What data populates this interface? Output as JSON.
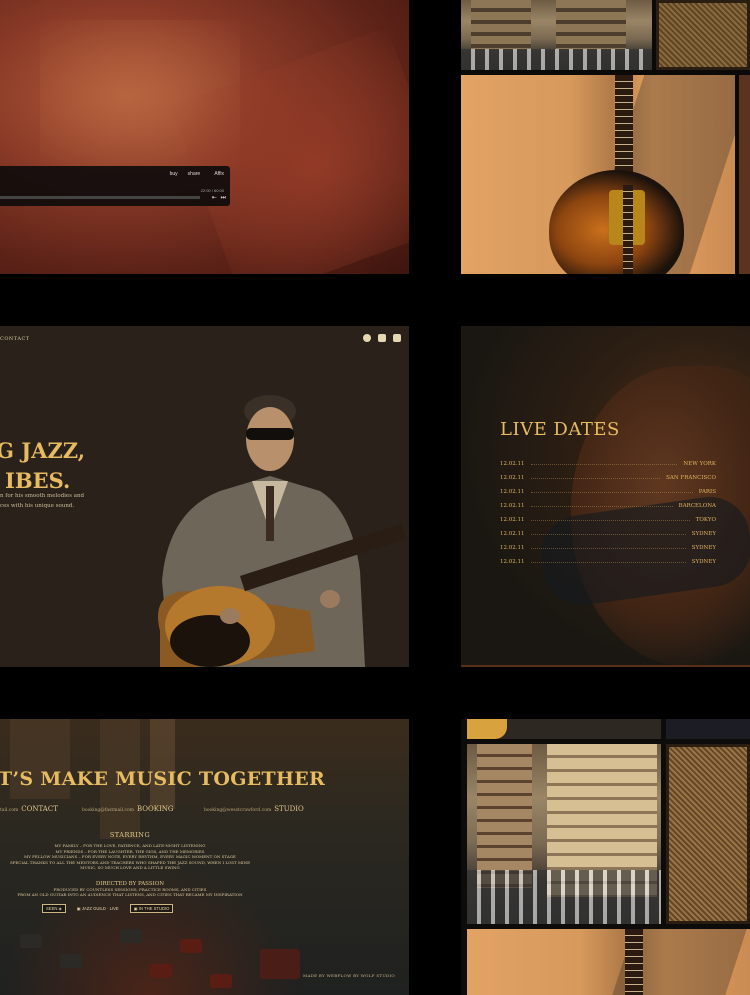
{
  "player": {
    "links": [
      "buy",
      "share",
      "   Affix"
    ],
    "time": "22:00 / 60:00",
    "skip_back": "⇤",
    "skip_forward": "⏭"
  },
  "hero": {
    "nav_contact": "CONTACT",
    "title_line1": "G JAZZ,",
    "title_line2": "IBES.",
    "desc_line1": "n for his smooth melodies and",
    "desc_line2": "ces with his unique sound.",
    "social_icons": [
      "spotify-icon",
      "youtube-icon",
      "instagram-icon"
    ]
  },
  "live": {
    "heading": "LIVE DATES",
    "dates": [
      {
        "date": "12.02.11",
        "city": "NEW YORK"
      },
      {
        "date": "12.02.11",
        "city": "SAN FRANCISCO"
      },
      {
        "date": "12.02.11",
        "city": "PARIS"
      },
      {
        "date": "12.02.11",
        "city": "BARCELONA"
      },
      {
        "date": "12.02.11",
        "city": "TOKYO"
      },
      {
        "date": "12.02.11",
        "city": "SYDNEY"
      },
      {
        "date": "12.02.11",
        "city": "SYDNEY"
      },
      {
        "date": "12.02.11",
        "city": "SYDNEY"
      }
    ]
  },
  "contact": {
    "heading": "T’S MAKE MUSIC TOGETHER",
    "items": [
      {
        "email": "tail.com",
        "label": "CONTACT"
      },
      {
        "email": "booking@fastmail.com",
        "label": "BOOKING"
      },
      {
        "email": "booking@wesstcrawford.com",
        "label": "STUDIO"
      }
    ],
    "starring_heading": "STARRING",
    "starring_lines": [
      "MY FAMILY – FOR THE LOVE, PATIENCE, AND LATE-NIGHT LISTENING",
      "MY FRIENDS – FOR THE LAUGHTER, THE GIGS, AND THE MEMORIES",
      "MY FELLOW MUSICIANS – FOR EVERY NOTE, EVERY RHYTHM, EVERY MAGIC MOMENT ON STAGE",
      "SPECIAL THANKS TO ALL THE MENTORS AND TEACHERS WHO SHAPED THE JAZZ SOUND, WHEN I LOST MINE",
      "MUSIC, SO MUCH LOVE AND A LITTLE SWING"
    ],
    "directed_heading": "DIRECTED BY PASSION",
    "directed_lines": [
      "PRODUCED BY COUNTLESS SESSIONS, PRACTICE ROOMS, AND CITIES",
      "FROM AN OLD GUITAR INTO AN AUDIENCE THAT LISTENS, AND CITIES THAT BECAME MY INSPIRATION"
    ],
    "buttons": [
      {
        "label": "SEEN ◈",
        "boxed": true
      },
      {
        "label": "▣ JAZZ GUILD · LIVE",
        "boxed": false
      },
      {
        "label": "▣ IN THE STUDIO",
        "boxed": true
      }
    ],
    "made_by": "MADE BY WEBFLOW BY WOLF STUDIO"
  }
}
